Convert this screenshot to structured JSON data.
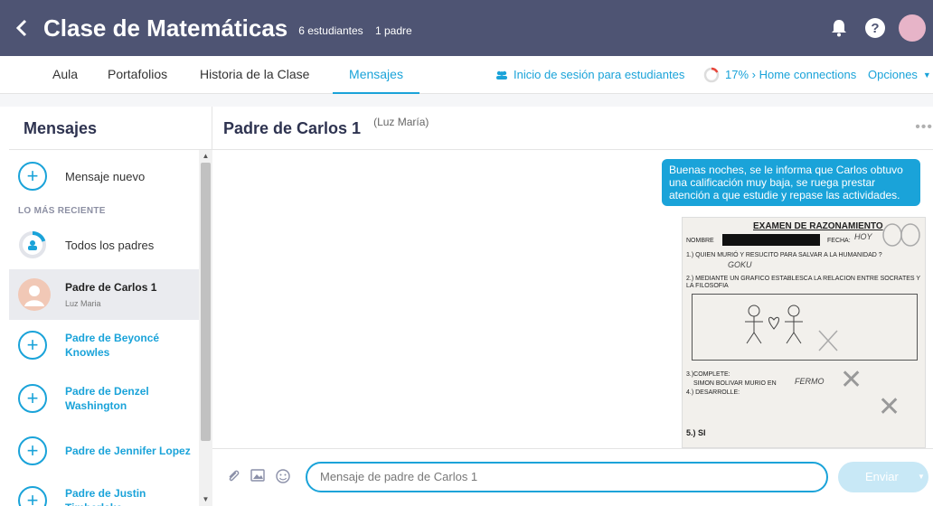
{
  "header": {
    "title": "Clase de Matemáticas",
    "students": "6 estudiantes",
    "parents": "1 padre"
  },
  "tabs": [
    {
      "label": "Aula"
    },
    {
      "label": "Portafolios"
    },
    {
      "label": "Historia de la Clase"
    },
    {
      "label": "Mensajes"
    }
  ],
  "tab_right": {
    "student_login": "Inicio de sesión para estudiantes",
    "home_connections": "17% › Home connections",
    "options": "Opciones"
  },
  "sidebar": {
    "title": "Mensajes",
    "new_message": "Mensaje nuevo",
    "section_recent": "LO MÁS RECIENTE",
    "items": [
      {
        "label": "Todos los padres"
      },
      {
        "label": "Padre de Carlos 1",
        "sub": "Luz Maria"
      },
      {
        "label": "Padre de Beyoncé Knowles"
      },
      {
        "label": "Padre de Denzel Washington"
      },
      {
        "label": "Padre de Jennifer Lopez"
      },
      {
        "label": "Padre de Justin Timberlake"
      }
    ]
  },
  "conversation": {
    "name": "Padre de Carlos 1",
    "sub": "(Luz María)",
    "message": "Buenas noches, se le informa que Carlos obtuvo una calificación muy baja, se ruega prestar atención a que estudie y repase las actividades.",
    "exam": {
      "title": "EXAMEN DE RAZONAMIENTO",
      "nombre": "NOMBRE",
      "fecha": "FECHA:",
      "fecha_value": "HOY",
      "q1": "1.) QUIEN MURIÓ Y RESUCITO PARA SALVAR A LA HUMANIDAD ?",
      "a1": "GOKU",
      "q2": "2.) MEDIANTE UN GRAFICO ESTABLESCA LA RELACION ENTRE SOCRATES Y LA FILOSOFIA",
      "q3": "3.)COMPLETE:",
      "q3_text": "SIMON BOLIVAR MURIO EN",
      "a3": "FERMO",
      "q4": "4.) DESARROLLE:",
      "q5": "5.) SI"
    }
  },
  "composer": {
    "placeholder": "Mensaje de padre de Carlos 1",
    "send": "Enviar"
  },
  "colors": {
    "topbar": "#4e5473",
    "accent": "#1aa3d9"
  }
}
